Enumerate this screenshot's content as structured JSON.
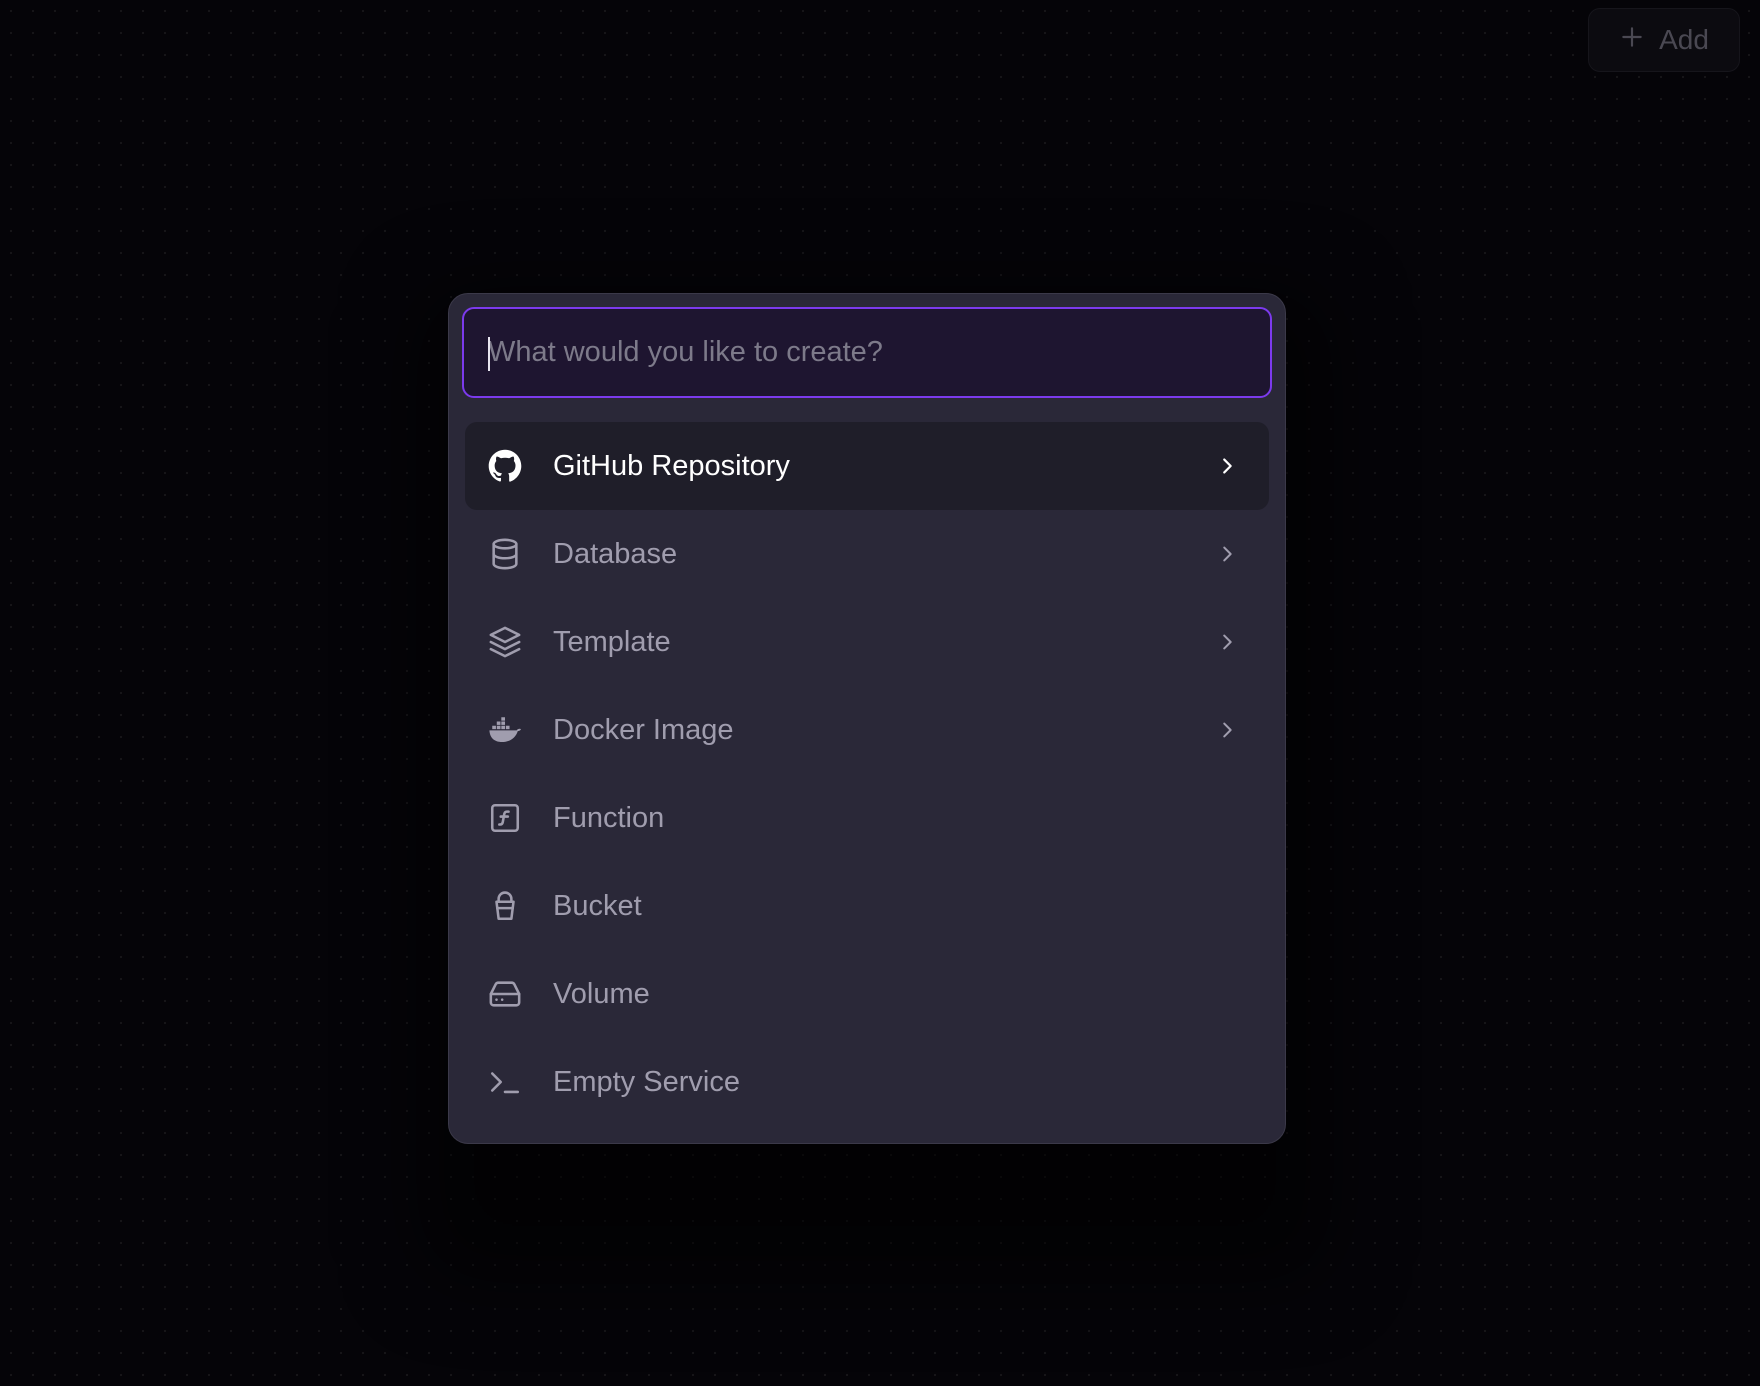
{
  "topbar": {
    "add_label": "Add",
    "add_icon": "plus-icon"
  },
  "palette": {
    "search": {
      "placeholder": "What would you like to create?",
      "value": ""
    },
    "items": [
      {
        "label": "GitHub Repository",
        "icon": "github-icon",
        "has_submenu": true,
        "active": true
      },
      {
        "label": "Database",
        "icon": "database-icon",
        "has_submenu": true,
        "active": false
      },
      {
        "label": "Template",
        "icon": "layers-icon",
        "has_submenu": true,
        "active": false
      },
      {
        "label": "Docker Image",
        "icon": "docker-icon",
        "has_submenu": true,
        "active": false
      },
      {
        "label": "Function",
        "icon": "function-icon",
        "has_submenu": false,
        "active": false
      },
      {
        "label": "Bucket",
        "icon": "bucket-icon",
        "has_submenu": false,
        "active": false
      },
      {
        "label": "Volume",
        "icon": "hard-drive-icon",
        "has_submenu": false,
        "active": false
      },
      {
        "label": "Empty Service",
        "icon": "terminal-icon",
        "has_submenu": false,
        "active": false
      }
    ]
  },
  "colors": {
    "background": "#050408",
    "palette_bg": "#2a2838",
    "accent": "#7c3aed",
    "active_item_bg": "#1f1e29"
  }
}
